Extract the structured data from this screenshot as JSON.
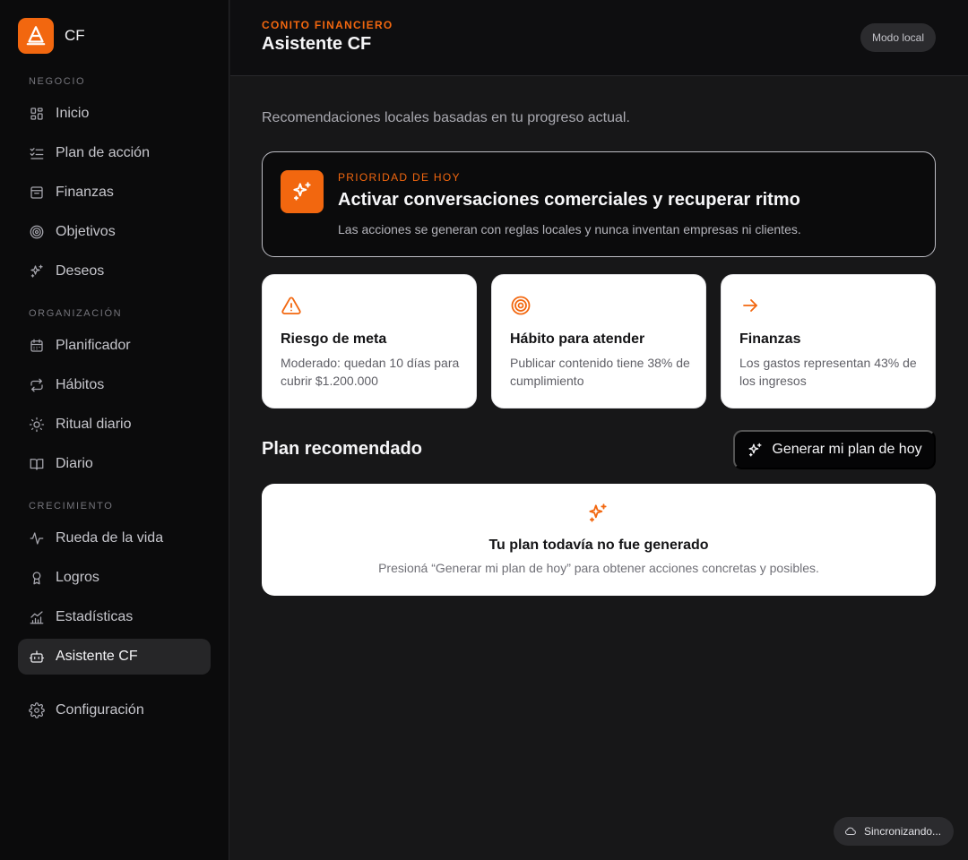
{
  "brand": {
    "name": "CF",
    "logo_icon": "cone-icon",
    "accent": "#f2670f"
  },
  "sidebar": {
    "sections": [
      {
        "label": "NEGOCIO"
      },
      {
        "label": "ORGANIZACIÓN"
      },
      {
        "label": "CRECIMIENTO"
      }
    ],
    "items": [
      {
        "label": "Inicio",
        "icon": "grid-icon"
      },
      {
        "label": "Plan de acción",
        "icon": "checklist-icon"
      },
      {
        "label": "Finanzas",
        "icon": "wallet-icon"
      },
      {
        "label": "Objetivos",
        "icon": "target-icon"
      },
      {
        "label": "Deseos",
        "icon": "sparkles-icon"
      },
      {
        "label": "Planificador",
        "icon": "calendar-icon"
      },
      {
        "label": "Hábitos",
        "icon": "repeat-icon"
      },
      {
        "label": "Ritual diario",
        "icon": "sun-icon"
      },
      {
        "label": "Diario",
        "icon": "book-icon"
      },
      {
        "label": "Rueda de la vida",
        "icon": "activity-icon"
      },
      {
        "label": "Logros",
        "icon": "award-icon"
      },
      {
        "label": "Estadísticas",
        "icon": "chart-icon"
      },
      {
        "label": "Asistente CF",
        "icon": "bot-icon",
        "active": true
      },
      {
        "label": "Configuración",
        "icon": "gear-icon"
      }
    ]
  },
  "header": {
    "kicker": "CONITO FINANCIERO",
    "title": "Asistente CF",
    "mode": "Modo local"
  },
  "main": {
    "subtitle": "Recomendaciones locales basadas en tu progreso actual.",
    "priority": {
      "kicker": "PRIORIDAD DE HOY",
      "title": "Activar conversaciones comerciales y recuperar ritmo",
      "description": "Las acciones se generan con reglas locales y nunca inventan empresas ni clientes."
    },
    "cards": [
      {
        "icon": "warning-icon",
        "title": "Riesgo de meta",
        "description": "Moderado: quedan 10 días para cubrir $1.200.000"
      },
      {
        "icon": "target-icon",
        "title": "Hábito para atender",
        "description": "Publicar contenido tiene 38% de cumplimiento"
      },
      {
        "icon": "arrow-right-icon",
        "title": "Finanzas",
        "description": "Los gastos representan 43% de los ingresos"
      }
    ],
    "plan": {
      "heading": "Plan recomendado",
      "generate_label": "Generar mi plan de hoy",
      "empty_title": "Tu plan todavía no fue generado",
      "empty_description": "Presioná “Generar mi plan de hoy” para obtener acciones concretas y posibles."
    }
  },
  "status": {
    "sync_label": "Sincronizando..."
  }
}
